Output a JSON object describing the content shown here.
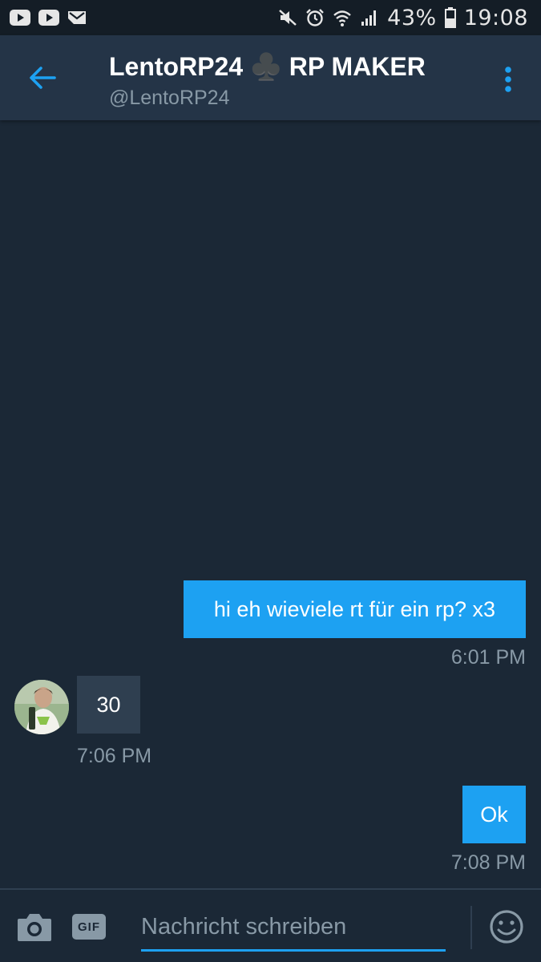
{
  "status_bar": {
    "battery_text": "43%",
    "time": "19:08",
    "icons": [
      "youtube-icon",
      "youtube-icon",
      "mail-icon",
      "mute-icon",
      "alarm-icon",
      "wifi-icon",
      "signal-icon",
      "battery-icon"
    ]
  },
  "header": {
    "title": "LentoRP24 ♣️ RP MAKER",
    "handle": "@LentoRP24",
    "back_icon": "arrow-left-icon",
    "menu_icon": "more-vertical-icon"
  },
  "messages": [
    {
      "direction": "outgoing",
      "text": "hi eh wieviele rt für ein rp? x3",
      "time": "6:01 PM"
    },
    {
      "direction": "incoming",
      "text": "30",
      "time": "7:06 PM"
    },
    {
      "direction": "outgoing",
      "text": "Ok",
      "time": "7:08 PM"
    }
  ],
  "composer": {
    "placeholder": "Nachricht schreiben",
    "gif_label": "GIF",
    "camera_icon": "camera-icon",
    "emoji_icon": "emoji-icon"
  },
  "colors": {
    "background": "#1b2836",
    "header": "#243447",
    "accent": "#1da1f2",
    "incoming_bubble": "#2f3f50",
    "muted_text": "#8899a6"
  }
}
